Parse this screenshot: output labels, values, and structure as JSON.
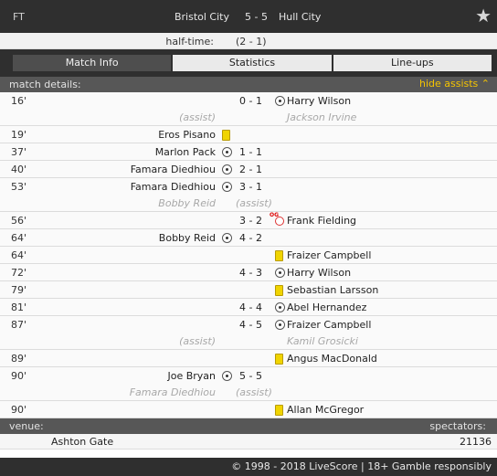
{
  "header": {
    "status": "FT",
    "home": "Bristol City",
    "score": "5 - 5",
    "away": "Hull City"
  },
  "halftime": {
    "label": "half-time:",
    "value": "(2 - 1)"
  },
  "tabs": [
    "Match Info",
    "Statistics",
    "Line-ups"
  ],
  "details": {
    "label": "match details:",
    "hide": "hide assists"
  },
  "events": [
    {
      "min": "16'",
      "side": "away",
      "type": "goal",
      "score": "0 - 1",
      "player": "Harry Wilson",
      "assist_label": "(assist)",
      "assist": "Jackson Irvine"
    },
    {
      "min": "19'",
      "side": "home",
      "type": "yellow",
      "player": "Eros Pisano"
    },
    {
      "min": "37'",
      "side": "home",
      "type": "goal",
      "score": "1 - 1",
      "player": "Marlon Pack"
    },
    {
      "min": "40'",
      "side": "home",
      "type": "goal",
      "score": "2 - 1",
      "player": "Famara Diedhiou"
    },
    {
      "min": "53'",
      "side": "home",
      "type": "goal",
      "score": "3 - 1",
      "player": "Famara Diedhiou",
      "assist_label": "(assist)",
      "assist": "Bobby Reid"
    },
    {
      "min": "56'",
      "side": "away",
      "type": "owngoal",
      "score": "3 - 2",
      "player": "Frank Fielding",
      "og_label": "OG"
    },
    {
      "min": "64'",
      "side": "home",
      "type": "goal",
      "score": "4 - 2",
      "player": "Bobby Reid"
    },
    {
      "min": "64'",
      "side": "away",
      "type": "yellow",
      "player": "Fraizer Campbell"
    },
    {
      "min": "72'",
      "side": "away",
      "type": "goal",
      "score": "4 - 3",
      "player": "Harry Wilson"
    },
    {
      "min": "79'",
      "side": "away",
      "type": "yellow",
      "player": "Sebastian Larsson"
    },
    {
      "min": "81'",
      "side": "away",
      "type": "goal",
      "score": "4 - 4",
      "player": "Abel Hernandez"
    },
    {
      "min": "87'",
      "side": "away",
      "type": "goal",
      "score": "4 - 5",
      "player": "Fraizer Campbell",
      "assist_label": "(assist)",
      "assist": "Kamil Grosicki"
    },
    {
      "min": "89'",
      "side": "away",
      "type": "yellow",
      "player": "Angus MacDonald"
    },
    {
      "min": "90'",
      "side": "home",
      "type": "goal",
      "score": "5 - 5",
      "player": "Joe Bryan",
      "assist_label": "(assist)",
      "assist": "Famara Diedhiou"
    },
    {
      "min": "90'",
      "side": "away",
      "type": "yellow",
      "player": "Allan McGregor"
    }
  ],
  "venue": {
    "venue_label": "venue:",
    "spectators_label": "spectators:",
    "venue": "Ashton Gate",
    "spectators": "21136"
  },
  "footer": "© 1998 - 2018 LiveScore | 18+ Gamble responsibly",
  "colors": {
    "dark": "#2f2f2f",
    "yellow_card": "#f0d400",
    "accent": "#f5c400"
  }
}
